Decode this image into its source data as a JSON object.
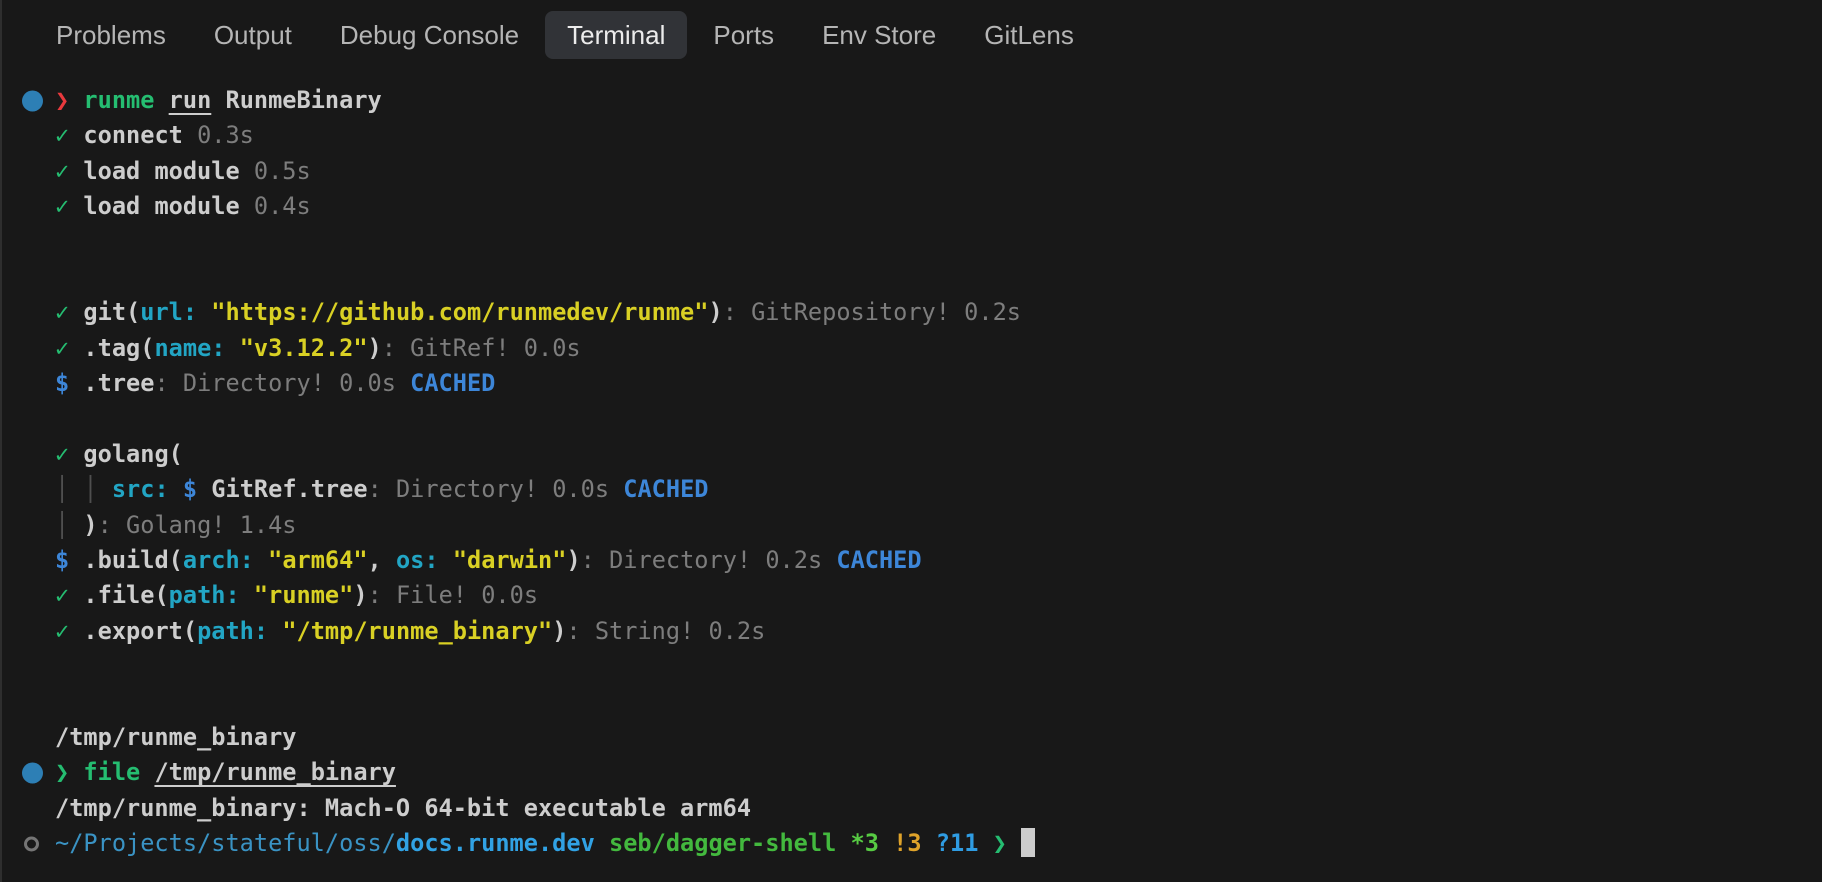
{
  "tabs": {
    "items": [
      {
        "id": "problems",
        "label": "Problems",
        "active": false
      },
      {
        "id": "output",
        "label": "Output",
        "active": false
      },
      {
        "id": "debug-console",
        "label": "Debug Console",
        "active": false
      },
      {
        "id": "terminal",
        "label": "Terminal",
        "active": true
      },
      {
        "id": "ports",
        "label": "Ports",
        "active": false
      },
      {
        "id": "env-store",
        "label": "Env Store",
        "active": false
      },
      {
        "id": "gitlens",
        "label": "GitLens",
        "active": false
      }
    ]
  },
  "colors": {
    "background": "#181818",
    "accent_blue": "#3d86d8",
    "accent_green": "#25bd71",
    "accent_red": "#e8393d",
    "accent_yellow": "#d9d024",
    "accent_cyan": "#22a5c4",
    "decoration_circle": "#2d7fb5"
  },
  "terminal": {
    "lines": [
      {
        "badge": "filled",
        "segments": [
          {
            "text": "❯ ",
            "style": "red",
            "name": "prompt-chevron-icon"
          },
          {
            "text": "runme ",
            "style": "grn"
          },
          {
            "text": "run",
            "style": "fg",
            "link": true
          },
          {
            "text": " RunmeBinary",
            "style": "fg"
          }
        ]
      },
      {
        "segments": [
          {
            "text": "✓ ",
            "style": "grn",
            "name": "check-icon"
          },
          {
            "text": "connect ",
            "style": "fg"
          },
          {
            "text": "0.3s",
            "style": "dim"
          }
        ]
      },
      {
        "segments": [
          {
            "text": "✓ ",
            "style": "grn",
            "name": "check-icon"
          },
          {
            "text": "load module ",
            "style": "fg"
          },
          {
            "text": "0.5s",
            "style": "dim"
          }
        ]
      },
      {
        "segments": [
          {
            "text": "✓ ",
            "style": "grn",
            "name": "check-icon"
          },
          {
            "text": "load module ",
            "style": "fg"
          },
          {
            "text": "0.4s",
            "style": "dim"
          }
        ]
      },
      {
        "segments": []
      },
      {
        "segments": []
      },
      {
        "segments": [
          {
            "text": "✓ ",
            "style": "grn",
            "name": "check-icon"
          },
          {
            "text": "git(",
            "style": "fg"
          },
          {
            "text": "url:",
            "style": "cyn"
          },
          {
            "text": " ",
            "style": "fg"
          },
          {
            "text": "\"https://github.com/runmedev/runme\"",
            "style": "yel"
          },
          {
            "text": ")",
            "style": "fg"
          },
          {
            "text": ": GitRepository! 0.2s",
            "style": "dim"
          }
        ]
      },
      {
        "segments": [
          {
            "text": "✓ ",
            "style": "grn",
            "name": "check-icon"
          },
          {
            "text": ".tag(",
            "style": "fg"
          },
          {
            "text": "name:",
            "style": "cyn"
          },
          {
            "text": " ",
            "style": "fg"
          },
          {
            "text": "\"v3.12.2\"",
            "style": "yel"
          },
          {
            "text": ")",
            "style": "fg"
          },
          {
            "text": ": GitRef! 0.0s",
            "style": "dim"
          }
        ]
      },
      {
        "segments": [
          {
            "text": "$",
            "style": "blu"
          },
          {
            "text": " .tree",
            "style": "fg"
          },
          {
            "text": ": Directory! 0.0s ",
            "style": "dim"
          },
          {
            "text": "CACHED",
            "style": "blu"
          }
        ]
      },
      {
        "segments": []
      },
      {
        "segments": [
          {
            "text": "✓ ",
            "style": "grn",
            "name": "check-icon"
          },
          {
            "text": "golang(",
            "style": "fg"
          }
        ]
      },
      {
        "segments": [
          {
            "text": "│ │ ",
            "style": "bar",
            "name": "tree-guide"
          },
          {
            "text": "src:",
            "style": "cyn"
          },
          {
            "text": " ",
            "style": "fg"
          },
          {
            "text": "$",
            "style": "blu"
          },
          {
            "text": " GitRef.tree",
            "style": "fg"
          },
          {
            "text": ": Directory! 0.0s ",
            "style": "dim"
          },
          {
            "text": "CACHED",
            "style": "blu"
          }
        ]
      },
      {
        "segments": [
          {
            "text": "│ ",
            "style": "bar",
            "name": "tree-guide"
          },
          {
            "text": ")",
            "style": "fg"
          },
          {
            "text": ": Golang! 1.4s",
            "style": "dim"
          }
        ]
      },
      {
        "segments": [
          {
            "text": "$",
            "style": "blu"
          },
          {
            "text": " .build(",
            "style": "fg"
          },
          {
            "text": "arch:",
            "style": "cyn"
          },
          {
            "text": " ",
            "style": "fg"
          },
          {
            "text": "\"arm64\"",
            "style": "yel"
          },
          {
            "text": ", ",
            "style": "fg"
          },
          {
            "text": "os:",
            "style": "cyn"
          },
          {
            "text": " ",
            "style": "fg"
          },
          {
            "text": "\"darwin\"",
            "style": "yel"
          },
          {
            "text": ")",
            "style": "fg"
          },
          {
            "text": ": Directory! 0.2s ",
            "style": "dim"
          },
          {
            "text": "CACHED",
            "style": "blu"
          }
        ]
      },
      {
        "segments": [
          {
            "text": "✓ ",
            "style": "grn",
            "name": "check-icon"
          },
          {
            "text": ".file(",
            "style": "fg"
          },
          {
            "text": "path:",
            "style": "cyn"
          },
          {
            "text": " ",
            "style": "fg"
          },
          {
            "text": "\"runme\"",
            "style": "yel"
          },
          {
            "text": ")",
            "style": "fg"
          },
          {
            "text": ": File! 0.0s",
            "style": "dim"
          }
        ]
      },
      {
        "segments": [
          {
            "text": "✓ ",
            "style": "grn",
            "name": "check-icon"
          },
          {
            "text": ".export(",
            "style": "fg"
          },
          {
            "text": "path:",
            "style": "cyn"
          },
          {
            "text": " ",
            "style": "fg"
          },
          {
            "text": "\"/tmp/runme_binary\"",
            "style": "yel"
          },
          {
            "text": ")",
            "style": "fg"
          },
          {
            "text": ": String! 0.2s",
            "style": "dim"
          }
        ]
      },
      {
        "segments": []
      },
      {
        "segments": []
      },
      {
        "segments": [
          {
            "text": "/tmp/runme_binary",
            "style": "fg"
          }
        ]
      },
      {
        "badge": "filled",
        "segments": [
          {
            "text": "❯ ",
            "style": "grn",
            "name": "prompt-chevron-icon"
          },
          {
            "text": "file ",
            "style": "grn"
          },
          {
            "text": "/tmp/runme_binary",
            "style": "fg",
            "link": true
          }
        ]
      },
      {
        "segments": [
          {
            "text": "/tmp/runme_binary: Mach-O 64-bit executable arm64",
            "style": "fg"
          }
        ]
      },
      {
        "badge": "hollow",
        "cursor": true,
        "segments": [
          {
            "text": "~/Projects/stateful/oss/",
            "style": "pathdim"
          },
          {
            "text": "docs.runme.dev",
            "style": "pathbold"
          },
          {
            "text": " ",
            "style": "fg"
          },
          {
            "text": "seb/dagger-shell",
            "style": "brgrn"
          },
          {
            "text": " ",
            "style": "fg"
          },
          {
            "text": "*3",
            "style": "lime"
          },
          {
            "text": " ",
            "style": "fg"
          },
          {
            "text": "!3",
            "style": "org"
          },
          {
            "text": " ",
            "style": "fg"
          },
          {
            "text": "?11",
            "style": "qblu"
          },
          {
            "text": " ",
            "style": "fg"
          },
          {
            "text": "❯ ",
            "style": "grn",
            "name": "prompt-chevron-icon"
          }
        ]
      }
    ]
  }
}
